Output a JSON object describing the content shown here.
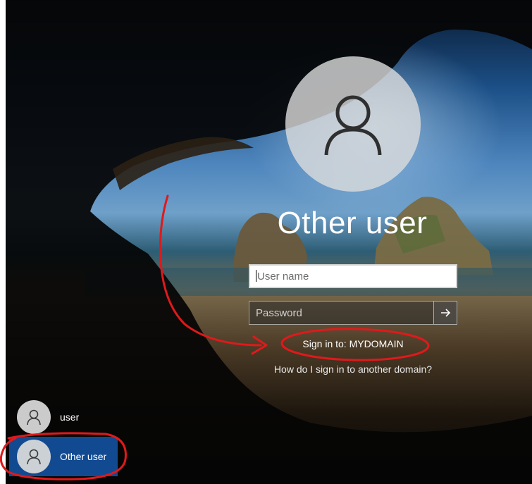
{
  "login": {
    "display_name": "Other user",
    "username_placeholder": "User name",
    "username_value": "",
    "password_placeholder": "Password",
    "signin_target": "Sign in to: MYDOMAIN",
    "other_domain_link": "How do I sign in to another domain?"
  },
  "user_list": [
    {
      "label": "user",
      "selected": false
    },
    {
      "label": "Other user",
      "selected": true
    }
  ],
  "colors": {
    "selected_tile": "#124a92",
    "annotation": "#e0191b",
    "avatar_bg": "#dcdcdc"
  },
  "icons": {
    "avatar": "person-icon",
    "submit": "arrow-right-icon"
  }
}
